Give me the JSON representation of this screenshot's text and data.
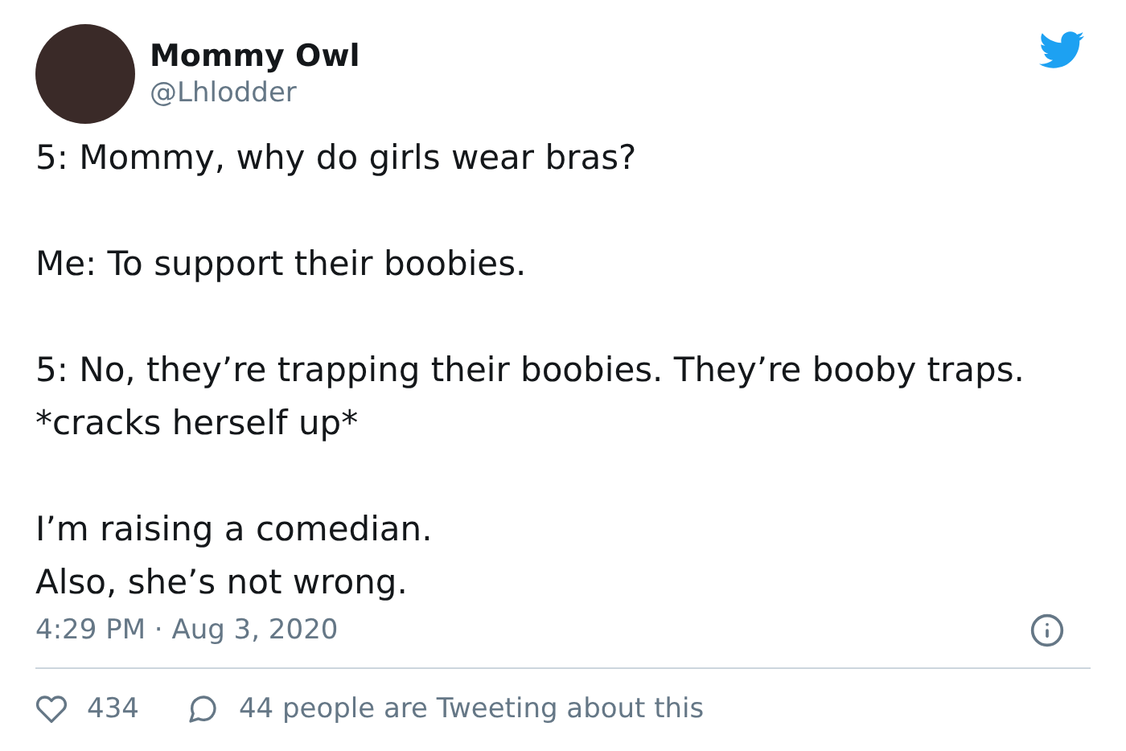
{
  "author": {
    "name": "Mommy Owl",
    "handle": "@Lhlodder"
  },
  "paragraphs": [
    "5: Mommy, why do girls wear bras?",
    "Me: To support their boobies.",
    "5: No, they’re trapping their boobies. They’re booby traps. *cracks herself up*",
    "I’m raising a comedian.\nAlso, she’s not wrong."
  ],
  "timestamp": "4:29 PM · Aug 3, 2020",
  "likes": "434",
  "replies": "44 people are Tweeting about this"
}
